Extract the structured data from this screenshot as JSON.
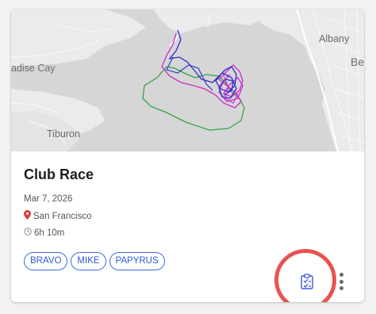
{
  "card": {
    "title": "Club Race",
    "date": "Mar 7, 2026",
    "location": "San Francisco",
    "duration": "6h 10m",
    "tags": [
      "BRAVO",
      "MIKE",
      "PAPYRUS"
    ]
  },
  "map": {
    "labels": {
      "albany": "Albany",
      "berkeley": "Be",
      "paradise_cay": "adise Cay",
      "tiburon": "Tiburon"
    },
    "track_colors": {
      "blue": "#2d2bd0",
      "magenta": "#cc2ccc",
      "green": "#34a34a"
    }
  },
  "icons": {
    "location": "location-pin-icon",
    "duration": "clock-icon",
    "report": "clipboard-report-icon",
    "more": "more-vert-icon"
  },
  "colors": {
    "tag_border": "#3d6fe0",
    "highlight_ring": "#e8534f"
  }
}
